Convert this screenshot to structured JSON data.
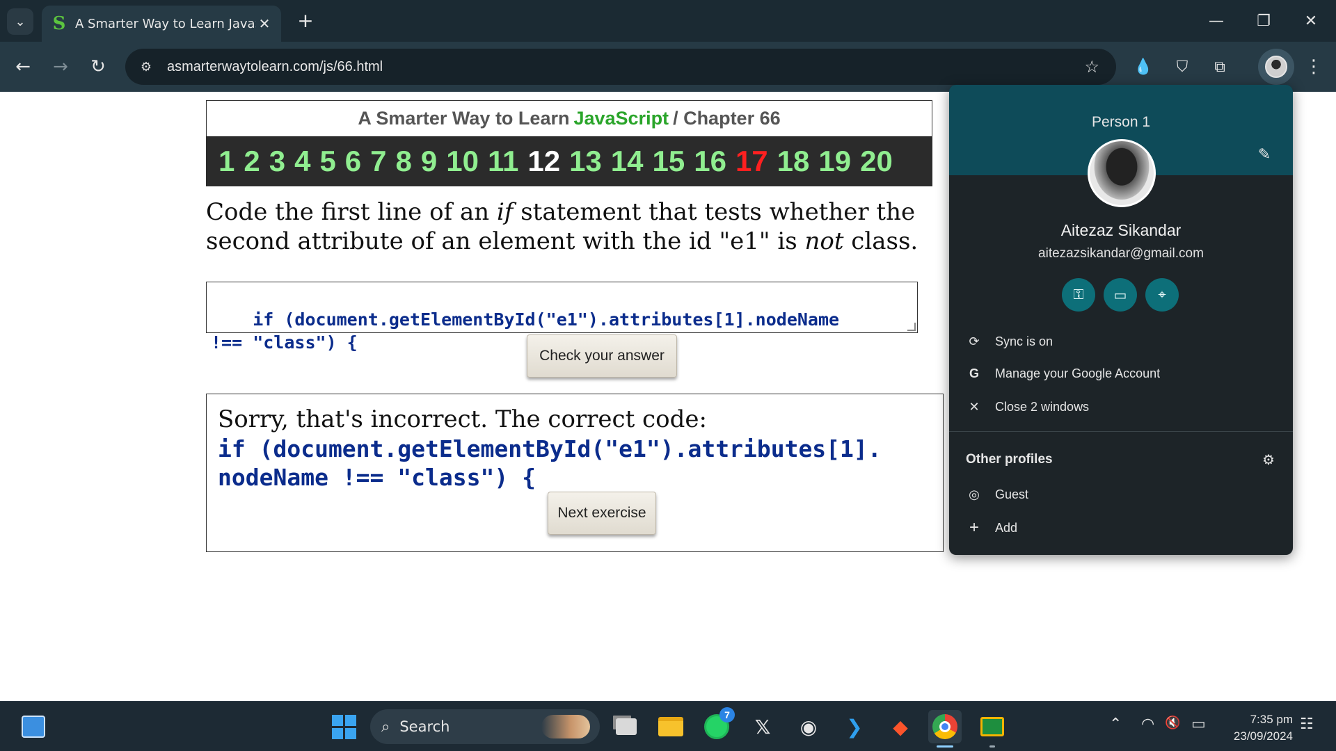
{
  "browser": {
    "tab_title": "A Smarter Way to Learn JavaScr",
    "favicon_letter": "S",
    "url": "asmarterwaytolearn.com/js/66.html",
    "icons": {
      "tab_menu": "chevron-down-icon",
      "close_tab": "close-icon",
      "new_tab": "plus-icon",
      "minimize": "minimize-icon",
      "restore": "restore-icon",
      "close_window": "close-icon",
      "back": "back-arrow-icon",
      "forward": "forward-arrow-icon",
      "reload": "reload-icon",
      "site_info": "tune-icon",
      "bookmark": "star-icon",
      "extensions": "puzzle-icon",
      "menu": "kebab-menu-icon"
    },
    "glyphs": {
      "tab_menu": "⌄",
      "close": "✕",
      "new_tab": "+",
      "minimize": "—",
      "restore": "❐",
      "back": "←",
      "forward": "→",
      "reload": "↻",
      "site_info": "⚙",
      "star": "☆",
      "drop": "💧",
      "shield": "⛉",
      "puzzle": "⧉",
      "menu": "⋮"
    }
  },
  "page": {
    "header": {
      "prefix": "A Smarter Way to Learn",
      "js": "JavaScript",
      "suffix": "/  Chapter 66"
    },
    "chapters": [
      {
        "n": "1",
        "state": "done"
      },
      {
        "n": "2",
        "state": "done"
      },
      {
        "n": "3",
        "state": "done"
      },
      {
        "n": "4",
        "state": "done"
      },
      {
        "n": "5",
        "state": "done"
      },
      {
        "n": "6",
        "state": "done"
      },
      {
        "n": "7",
        "state": "done"
      },
      {
        "n": "8",
        "state": "done"
      },
      {
        "n": "9",
        "state": "done"
      },
      {
        "n": "10",
        "state": "done"
      },
      {
        "n": "11",
        "state": "done"
      },
      {
        "n": "12",
        "state": "current"
      },
      {
        "n": "13",
        "state": "done"
      },
      {
        "n": "14",
        "state": "done"
      },
      {
        "n": "15",
        "state": "done"
      },
      {
        "n": "16",
        "state": "done"
      },
      {
        "n": "17",
        "state": "wrong"
      },
      {
        "n": "18",
        "state": "done"
      },
      {
        "n": "19",
        "state": "done"
      },
      {
        "n": "20",
        "state": "done"
      }
    ],
    "chapter_colors": {
      "done": "#90ee90",
      "current": "#ffffff",
      "wrong": "#ff2020"
    },
    "question": {
      "part1": "Code the first line of an ",
      "em1": "if",
      "part2": " statement that tests whether the second attribute of an element with the id \"e1\" is ",
      "em2": "not",
      "part3": " class."
    },
    "answer_value": "if (document.getElementById(\"e1\").attributes[1].nodeName\n!== \"class\") {",
    "check_button": "Check your answer",
    "result": {
      "message": "Sorry, that's incorrect. The correct code:",
      "code": "if (document.getElementById(\"e1\").attributes[1].\nnodeName !== \"class\") {"
    },
    "next_button": "Next exercise"
  },
  "profile_menu": {
    "profile_label": "Person 1",
    "name": "Aitezaz Sikandar",
    "email": "aitezazsikandar@gmail.com",
    "quick_actions": [
      {
        "icon": "key-icon",
        "glyph": "⚿"
      },
      {
        "icon": "credit-card-icon",
        "glyph": "▭"
      },
      {
        "icon": "location-pin-icon",
        "glyph": "⌖"
      }
    ],
    "items": [
      {
        "icon": "sync-icon",
        "glyph": "⟳",
        "label": "Sync is on"
      },
      {
        "icon": "google-icon",
        "glyph": "G",
        "label": "Manage your Google Account"
      },
      {
        "icon": "close-icon",
        "glyph": "✕",
        "label": "Close 2 windows"
      }
    ],
    "other_profiles_title": "Other profiles",
    "other_items": [
      {
        "icon": "guest-icon",
        "glyph": "◎",
        "label": "Guest"
      },
      {
        "icon": "plus-icon",
        "glyph": "+",
        "label": "Add"
      }
    ],
    "icons": {
      "edit": "pencil-icon",
      "settings": "gear-icon"
    },
    "glyphs": {
      "edit": "✎",
      "settings": "⚙"
    }
  },
  "taskbar": {
    "search_label": "Search",
    "whatsapp_badge": "7",
    "time": "7:35 pm",
    "date": "23/09/2024",
    "glyphs": {
      "search": "⌕",
      "x": "𝕏",
      "github": "◉",
      "vscode": "❯",
      "brave": "◆",
      "chevron_up": "⌃",
      "wifi": "◠",
      "mute": "🔇",
      "battery": "▭",
      "notification": "☷"
    }
  }
}
